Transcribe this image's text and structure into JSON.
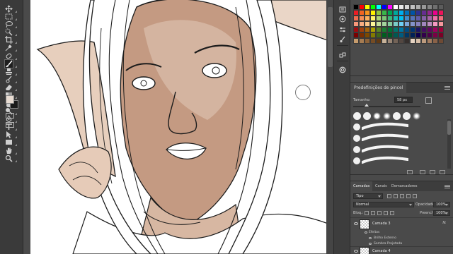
{
  "toolbar": {
    "tools": [
      {
        "icon": "move-icon"
      },
      {
        "icon": "marquee-icon"
      },
      {
        "icon": "lasso-icon"
      },
      {
        "icon": "quick-select-icon"
      },
      {
        "icon": "crop-icon"
      },
      {
        "icon": "eyedropper-icon"
      },
      {
        "icon": "healing-brush-icon"
      },
      {
        "icon": "brush-icon"
      },
      {
        "icon": "clone-stamp-icon"
      },
      {
        "icon": "history-brush-icon"
      },
      {
        "icon": "eraser-icon"
      },
      {
        "icon": "gradient-icon"
      },
      {
        "icon": "blur-icon"
      },
      {
        "icon": "dodge-icon"
      },
      {
        "icon": "pen-icon"
      },
      {
        "icon": "type-icon"
      },
      {
        "icon": "path-select-icon"
      },
      {
        "icon": "rectangle-icon"
      },
      {
        "icon": "hand-icon"
      },
      {
        "icon": "zoom-icon"
      }
    ],
    "foreground_color": "#e8dcd2",
    "background_color": "#1a1a1a"
  },
  "colors": {
    "skin_shade": "#b88b72",
    "skin_light": "#d9bca9",
    "line": "#1c1c1c",
    "selection_accent": "#4a7cc2"
  },
  "swatches_panel": {
    "colors": [
      "#000000",
      "#ff0000",
      "#ffff00",
      "#00ff00",
      "#00ffff",
      "#0000ff",
      "#ff00ff",
      "#ffffff",
      "#ebebeb",
      "#d6d6d6",
      "#c2c2c2",
      "#adadad",
      "#999999",
      "#858585",
      "#707070",
      "#5c5c5c",
      "#ed1c24",
      "#f26522",
      "#f7941d",
      "#fff200",
      "#8dc63f",
      "#39b54a",
      "#00a651",
      "#00a99d",
      "#00aeef",
      "#0072bc",
      "#0054a6",
      "#2e3192",
      "#662d91",
      "#92278f",
      "#ec008c",
      "#ed145b",
      "#f26c4f",
      "#f68e56",
      "#fbaf5d",
      "#fff568",
      "#acd373",
      "#7cc576",
      "#3cb878",
      "#1abbb4",
      "#00bff3",
      "#438ccb",
      "#5574b9",
      "#605ca8",
      "#8560a8",
      "#a763a8",
      "#f06eaa",
      "#f26d7d",
      "#f7977a",
      "#f9ad81",
      "#fdc68a",
      "#fff79a",
      "#c4df9b",
      "#a3d39c",
      "#82ca9d",
      "#7accc8",
      "#6dcff6",
      "#7da7d9",
      "#8393ca",
      "#8781bd",
      "#a187be",
      "#bc8dbf",
      "#f49ac2",
      "#f5989d",
      "#9e0b0f",
      "#a0410d",
      "#a3620a",
      "#aba000",
      "#598527",
      "#197b30",
      "#007236",
      "#00746b",
      "#0076a3",
      "#004a80",
      "#003471",
      "#1b1464",
      "#440e62",
      "#630460",
      "#9e005d",
      "#9e0039",
      "#790000",
      "#7b2e00",
      "#7d4900",
      "#827b00",
      "#406618",
      "#005e20",
      "#005826",
      "#005952",
      "#005b7f",
      "#003663",
      "#002157",
      "#0d004c",
      "#32004b",
      "#4b0049",
      "#7b0046",
      "#7a0026",
      "#c69c6d",
      "#a67c52",
      "#8c6239",
      "#754c24",
      "#603913",
      "#c7b299",
      "#998675",
      "#736357",
      "#534741",
      "#362f2d",
      "#e6d4c3",
      "#d7bfa8",
      "#bd9b7e",
      "#a37c5f",
      "#8a6248",
      "#6e4a34"
    ]
  },
  "mini_icons": [
    "history-icon",
    "color-icon",
    "adjustments-icon",
    "brush-settings-icon",
    "clone-source-icon",
    "paths-icon"
  ],
  "brush_panel": {
    "title": "Predefinições de pincel",
    "size_label": "Tamanho:",
    "size_value": "58 px",
    "size_fraction": 0.2
  },
  "layers_panel": {
    "tabs": [
      "Camadas",
      "Canais",
      "Demarcadores"
    ],
    "filter_label": "Tipo",
    "blend_mode": "Normal",
    "opacity_label": "Opacidade:",
    "opacity_value": "100%",
    "lock_label": "Bloq.:",
    "fill_label": "Preench.:",
    "fill_value": "100%",
    "layers": [
      {
        "name": "Camada 3",
        "fx": "fx",
        "effects_label": "Efeitos",
        "effects": [
          "Brilho Externo",
          "Sombra Projetada"
        ]
      },
      {
        "name": "Camada 4"
      }
    ]
  }
}
